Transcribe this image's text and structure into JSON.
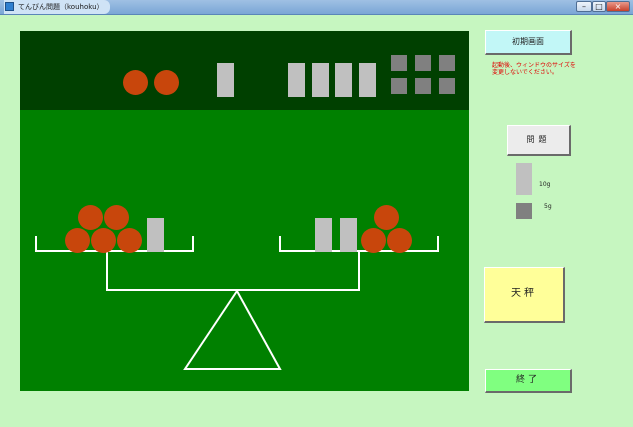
{
  "window": {
    "title": "てんびん問題（kouhoku）",
    "min_glyph": "–",
    "max_glyph": "□",
    "close_glyph": "×"
  },
  "scene": {
    "tray": {
      "balls": 2,
      "weights_10g": 5,
      "weights_5g": 6
    },
    "left_pan": {
      "balls": 5,
      "weights_10g": 1
    },
    "right_pan": {
      "balls": 3,
      "weights_10g": 2
    }
  },
  "panel": {
    "initial_screen_button": "初期画面",
    "warning_text": "起動後、ウィンドウのサイズを変更しないでください。",
    "problem_button": "問題",
    "legend_10g": "10g",
    "legend_5g": "5g",
    "weigh_button": "天秤",
    "exit_button": "終了"
  },
  "colors": {
    "background": "#c6f6c0",
    "scene": "#008000",
    "tray": "#004000",
    "ball": "#c8460c",
    "weight_10g": "#c0c0c0",
    "weight_5g": "#808080"
  }
}
